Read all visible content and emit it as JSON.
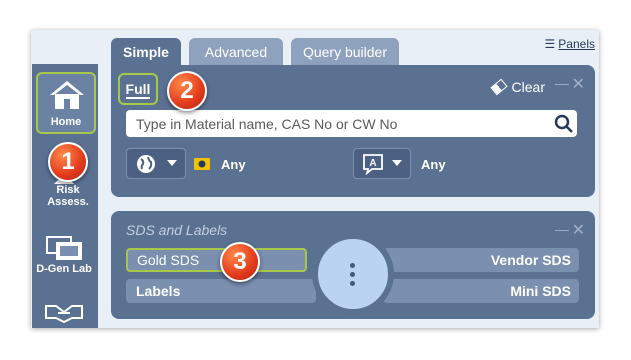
{
  "tabs": [
    {
      "label": "Simple",
      "active": true
    },
    {
      "label": "Advanced",
      "active": false
    },
    {
      "label": "Query builder",
      "active": false
    }
  ],
  "panels_link": "Panels",
  "sidebar": {
    "items": [
      {
        "label": "Home",
        "icon": "home-icon"
      },
      {
        "label": "Risk Assess.",
        "icon": "risk-assess-icon"
      },
      {
        "label": "D-Gen Lab",
        "icon": "d-gen-lab-icon"
      },
      {
        "label": "",
        "icon": "handshake-icon"
      }
    ]
  },
  "search_panel": {
    "full_label": "Full",
    "clear_label": "Clear",
    "search_placeholder": "Type in Material name, CAS No or CW No",
    "region_value": "Any",
    "language_value": "Any"
  },
  "sds_panel": {
    "title": "SDS and Labels",
    "gold_sds": "Gold SDS",
    "vendor_sds": "Vendor SDS",
    "labels": "Labels",
    "mini_sds": "Mini SDS"
  },
  "callouts": [
    "1",
    "2",
    "3"
  ],
  "colors": {
    "panel": "#5b7192",
    "highlight": "#a7c94a",
    "badge": "#e2391b",
    "row": "#7b8fae"
  }
}
